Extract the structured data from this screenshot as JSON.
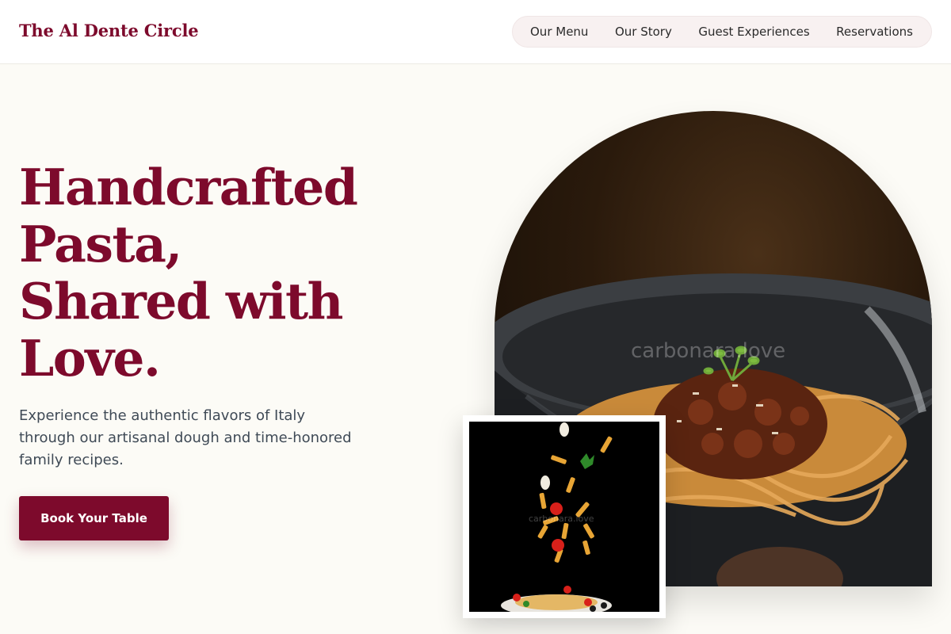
{
  "brand": {
    "name": "The Al Dente Circle"
  },
  "nav": {
    "items": [
      {
        "label": "Our Menu"
      },
      {
        "label": "Our Story"
      },
      {
        "label": "Guest Experiences"
      },
      {
        "label": "Reservations"
      }
    ]
  },
  "hero": {
    "title_lines": [
      "Handcrafted",
      "Pasta,",
      "Shared with",
      "Love."
    ],
    "subtitle_lines": [
      "Experience the authentic flavors of Italy",
      "through our artisanal dough and time-honored",
      "family recipes."
    ],
    "cta_label": "Book Your Table"
  },
  "images": {
    "main_watermark": "carbonara.love",
    "inset_watermark": "carbonara.love"
  },
  "colors": {
    "brand": "#7d0a2c",
    "background": "#fcfbf6",
    "nav_bg": "#f8f1f1",
    "text_muted": "#3f4a56"
  }
}
